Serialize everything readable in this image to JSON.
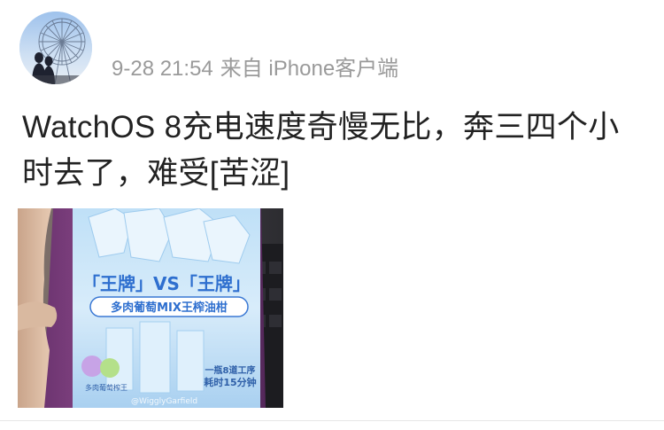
{
  "post": {
    "timestamp": "9-28 21:54",
    "source": "来自 iPhone客户端",
    "content": "WatchOS 8充电速度奇慢无比，奔三四个小时去了，难受[苦涩]"
  },
  "photo": {
    "label_vs": "「王牌」VS「王牌」",
    "product_name": "多肉葡萄MIX王榨油柑",
    "left_badge": "多肉葡萄榨王",
    "right_badge_line1": "一瓶8道工序",
    "right_badge_line2": "耗时15分钟",
    "watermark": "@WigglyGarfield"
  },
  "colors": {
    "meta_text": "#9a9a9a",
    "body_text": "#222222",
    "bottle_purple": "#7a3a7e",
    "label_blue": "#4a7fd6"
  }
}
